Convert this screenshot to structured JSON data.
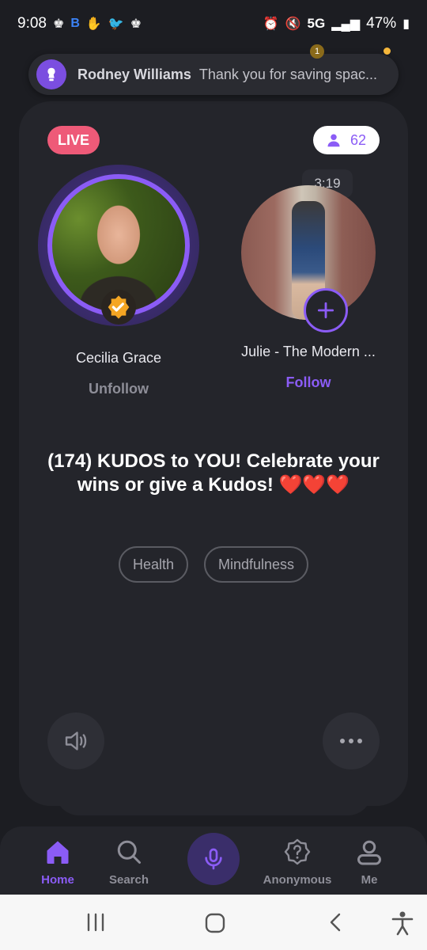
{
  "status_bar": {
    "time": "9:08",
    "network": "5G",
    "battery": "47%"
  },
  "notification": {
    "sender": "Rodney Williams",
    "message": "Thank you for saving spac...",
    "badge_count": "1"
  },
  "room": {
    "live_label": "LIVE",
    "listener_count": "62",
    "timer": "3:19",
    "title": "(174) KUDOS to YOU! Celebrate your wins or give a Kudos! ❤️❤️❤️",
    "tags": [
      "Health",
      "Mindfulness"
    ]
  },
  "speakers": [
    {
      "name": "Cecilia Grace",
      "action": "Unfollow"
    },
    {
      "name": "Julie - The Modern ...",
      "action": "Follow"
    }
  ],
  "bottom_nav": {
    "home": "Home",
    "search": "Search",
    "anonymous": "Anonymous",
    "me": "Me"
  },
  "colors": {
    "accent": "#8b5cf6",
    "live": "#ee5a78",
    "background": "#1c1d22",
    "card": "#24252b"
  }
}
